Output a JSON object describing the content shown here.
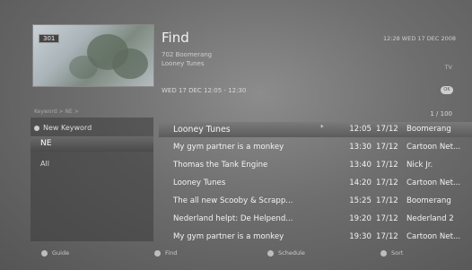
{
  "header": {
    "title": "Find",
    "clock": "12:28 WED 17 DEC 2008",
    "channel_line": "702 Boomerang",
    "program": "Looney Tunes",
    "tv_tag": "TV",
    "datetime": "WED 17 DEC 12:05 - 12:30",
    "ok_label": "OK"
  },
  "preview": {
    "channel_badge": "301"
  },
  "breadcrumb": "Keyword > NE >",
  "counter": "1 / 100",
  "keywords": {
    "new_label": "New Keyword",
    "items": [
      "NE",
      "All"
    ]
  },
  "results": [
    {
      "title": "Looney Tunes",
      "time": "12:05",
      "date": "17/12",
      "channel": "Boomerang",
      "mark": "*"
    },
    {
      "title": "My gym partner is a monkey",
      "time": "13:30",
      "date": "17/12",
      "channel": "Cartoon Net..."
    },
    {
      "title": "Thomas the Tank Engine",
      "time": "13:40",
      "date": "17/12",
      "channel": "Nick Jr."
    },
    {
      "title": "Looney Tunes",
      "time": "14:20",
      "date": "17/12",
      "channel": "Cartoon Net..."
    },
    {
      "title": "The all new Scooby & Scrapp...",
      "time": "15:25",
      "date": "17/12",
      "channel": "Boomerang"
    },
    {
      "title": "Nederland helpt: De Helpend...",
      "time": "19:20",
      "date": "17/12",
      "channel": "Nederland 2"
    },
    {
      "title": "My gym partner is a monkey",
      "time": "19:30",
      "date": "17/12",
      "channel": "Cartoon Net..."
    }
  ],
  "footer": {
    "guide": "Guide",
    "find": "Find",
    "schedule": "Schedule",
    "sort": "Sort"
  },
  "colors": {
    "accent": "#5c5c5c",
    "text": "#f3f3f3"
  }
}
